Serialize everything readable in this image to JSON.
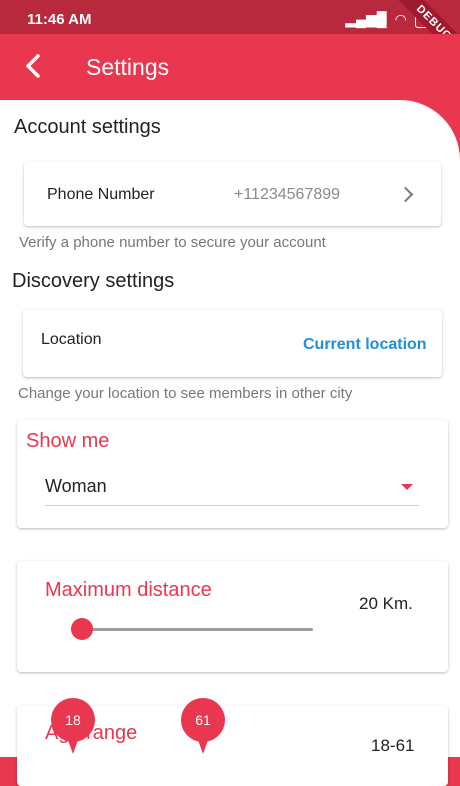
{
  "status_bar": {
    "time": "11:46 AM",
    "battery": "60",
    "debug_banner": "DEBUG"
  },
  "app_bar": {
    "title": "Settings"
  },
  "account": {
    "heading": "Account settings",
    "phone_label": "Phone Number",
    "phone_value": "+11234567899",
    "helper": "Verify a phone number to secure your account"
  },
  "discovery": {
    "heading": "Discovery settings",
    "location_label": "Location",
    "location_value": "Current location",
    "helper": "Change your location to see members in other city"
  },
  "show_me": {
    "label": "Show me",
    "selected": "Woman"
  },
  "distance": {
    "label": "Maximum distance",
    "value_text": "20 Km.",
    "fraction": 0.0
  },
  "age_range": {
    "label": "Age range",
    "value_text": "18-61",
    "min": 18,
    "max": 61
  },
  "colors": {
    "accent": "#e8374f",
    "status_bar": "#b8293d",
    "link": "#1f8fd8"
  },
  "icons": [
    "signal-icon",
    "wifi-icon",
    "battery-icon",
    "back-arrow-icon",
    "chevron-right-icon",
    "dropdown-caret-icon"
  ]
}
